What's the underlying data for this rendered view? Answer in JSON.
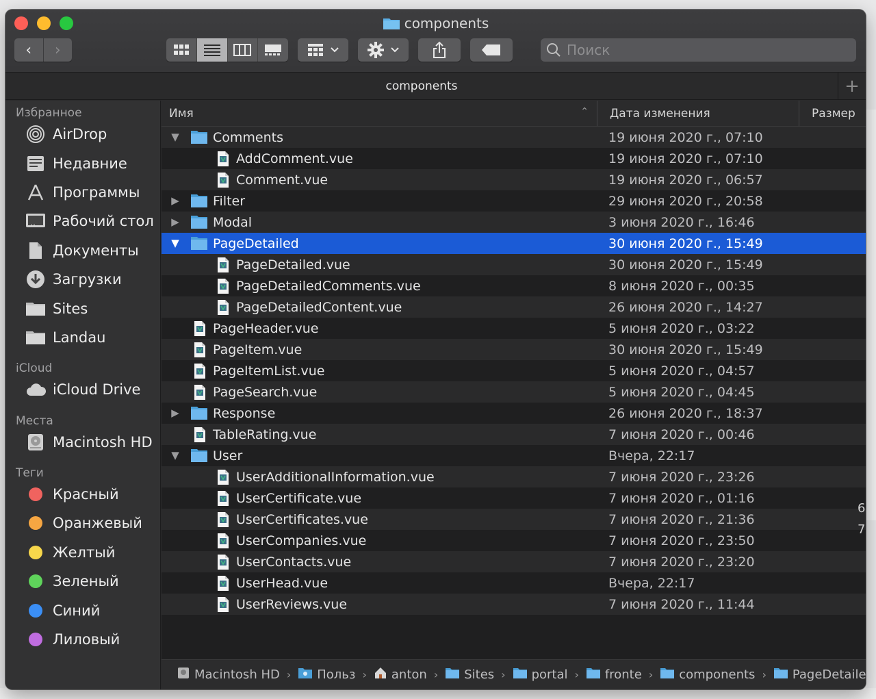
{
  "window": {
    "title": "components",
    "tab_label": "components"
  },
  "toolbar": {
    "back_label": "‹",
    "forward_label": "›",
    "search_placeholder": "Поиск"
  },
  "sidebar": {
    "favorites_header": "Избранное",
    "favorites": [
      {
        "label": "AirDrop",
        "icon": "airdrop-icon"
      },
      {
        "label": "Недавние",
        "icon": "recents-icon"
      },
      {
        "label": "Программы",
        "icon": "applications-icon"
      },
      {
        "label": "Рабочий стол",
        "icon": "desktop-icon"
      },
      {
        "label": "Документы",
        "icon": "documents-icon"
      },
      {
        "label": "Загрузки",
        "icon": "downloads-icon"
      },
      {
        "label": "Sites",
        "icon": "folder-icon"
      },
      {
        "label": "Landau",
        "icon": "folder-icon"
      }
    ],
    "icloud_header": "iCloud",
    "icloud": [
      {
        "label": "iCloud Drive",
        "icon": "cloud-icon"
      }
    ],
    "places_header": "Места",
    "places": [
      {
        "label": "Macintosh HD",
        "icon": "harddisk-icon"
      }
    ],
    "tags_header": "Теги",
    "tags": [
      {
        "label": "Красный",
        "color": "#f0635f"
      },
      {
        "label": "Оранжевый",
        "color": "#f6a642"
      },
      {
        "label": "Желтый",
        "color": "#f7d74b"
      },
      {
        "label": "Зеленый",
        "color": "#5fd35b"
      },
      {
        "label": "Синий",
        "color": "#3b8ff6"
      },
      {
        "label": "Лиловый",
        "color": "#c06de0"
      }
    ]
  },
  "columns": {
    "name": "Имя",
    "date": "Дата изменения",
    "size": "Размер"
  },
  "files": [
    {
      "name": "Comments",
      "date": "19 июня 2020 г., 07:10",
      "type": "folder",
      "level": 0,
      "expanded": true
    },
    {
      "name": "AddComment.vue",
      "date": "19 июня 2020 г., 07:10",
      "type": "file",
      "level": 1
    },
    {
      "name": "Comment.vue",
      "date": "19 июня 2020 г., 06:57",
      "type": "file",
      "level": 1
    },
    {
      "name": "Filter",
      "date": "29 июня 2020 г., 20:58",
      "type": "folder",
      "level": 0,
      "expanded": false
    },
    {
      "name": "Modal",
      "date": "3 июня 2020 г., 16:46",
      "type": "folder",
      "level": 0,
      "expanded": false
    },
    {
      "name": "PageDetailed",
      "date": "30 июня 2020 г., 15:49",
      "type": "folder",
      "level": 0,
      "expanded": true,
      "selected": true
    },
    {
      "name": "PageDetailed.vue",
      "date": "30 июня 2020 г., 15:49",
      "type": "file",
      "level": 1
    },
    {
      "name": "PageDetailedComments.vue",
      "date": "8 июня 2020 г., 00:35",
      "type": "file",
      "level": 1
    },
    {
      "name": "PageDetailedContent.vue",
      "date": "26 июня 2020 г., 14:27",
      "type": "file",
      "level": 1
    },
    {
      "name": "PageHeader.vue",
      "date": "5 июня 2020 г., 03:22",
      "type": "file",
      "level": 0
    },
    {
      "name": "PageItem.vue",
      "date": "30 июня 2020 г., 15:49",
      "type": "file",
      "level": 0
    },
    {
      "name": "PageItemList.vue",
      "date": "5 июня 2020 г., 04:57",
      "type": "file",
      "level": 0
    },
    {
      "name": "PageSearch.vue",
      "date": "5 июня 2020 г., 04:45",
      "type": "file",
      "level": 0
    },
    {
      "name": "Response",
      "date": "26 июня 2020 г., 18:37",
      "type": "folder",
      "level": 0,
      "expanded": false
    },
    {
      "name": "TableRating.vue",
      "date": "7 июня 2020 г., 00:46",
      "type": "file",
      "level": 0
    },
    {
      "name": "User",
      "date": "Вчера, 22:17",
      "type": "folder",
      "level": 0,
      "expanded": true
    },
    {
      "name": "UserAdditionalInformation.vue",
      "date": "7 июня 2020 г., 23:26",
      "type": "file",
      "level": 1
    },
    {
      "name": "UserCertificate.vue",
      "date": "7 июня 2020 г., 01:16",
      "type": "file",
      "level": 1
    },
    {
      "name": "UserCertificates.vue",
      "date": "7 июня 2020 г., 21:36",
      "type": "file",
      "level": 1
    },
    {
      "name": "UserCompanies.vue",
      "date": "7 июня 2020 г., 23:50",
      "type": "file",
      "level": 1
    },
    {
      "name": "UserContacts.vue",
      "date": "7 июня 2020 г., 23:20",
      "type": "file",
      "level": 1
    },
    {
      "name": "UserHead.vue",
      "date": "Вчера, 22:17",
      "type": "file",
      "level": 1
    },
    {
      "name": "UserReviews.vue",
      "date": "7 июня 2020 г., 11:44",
      "type": "file",
      "level": 1
    }
  ],
  "pathbar": [
    {
      "label": "Macintosh HD",
      "icon": "harddisk-icon"
    },
    {
      "label": "Польз",
      "icon": "users-folder-icon"
    },
    {
      "label": "anton",
      "icon": "home-icon"
    },
    {
      "label": "Sites",
      "icon": "folder-icon"
    },
    {
      "label": "portal",
      "icon": "folder-icon"
    },
    {
      "label": "fronte",
      "icon": "folder-icon"
    },
    {
      "label": "components",
      "icon": "folder-icon"
    },
    {
      "label": "PageDetailed",
      "icon": "folder-icon"
    }
  ],
  "background_fragments": {
    "size_cut_1": "6",
    "size_cut_2": "7"
  }
}
